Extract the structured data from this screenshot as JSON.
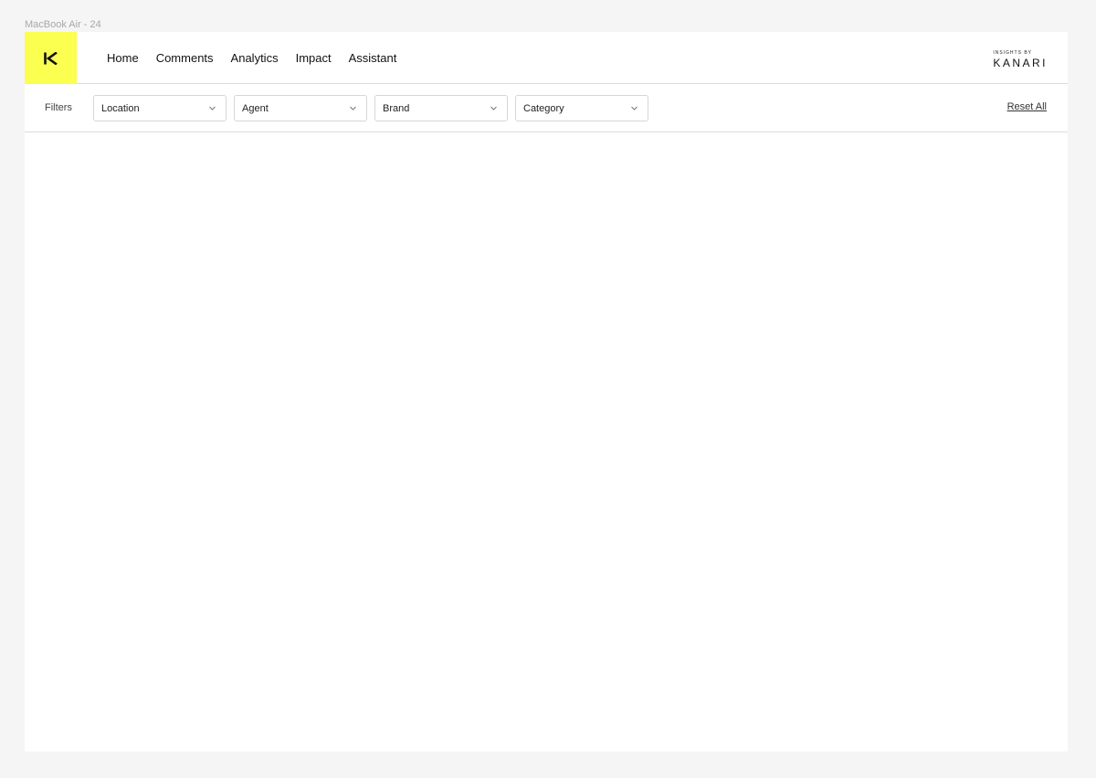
{
  "frame": {
    "label": "MacBook Air - 24"
  },
  "logo": {
    "letter": "K",
    "bg_color": "#fbff4f",
    "icon": "kanari-k-logo-icon"
  },
  "nav": {
    "items": [
      {
        "label": "Home"
      },
      {
        "label": "Comments"
      },
      {
        "label": "Analytics"
      },
      {
        "label": "Impact"
      },
      {
        "label": "Assistant"
      }
    ]
  },
  "brand": {
    "small": "INSIGHTS BY",
    "big": "KANARI"
  },
  "filters": {
    "label": "Filters",
    "selects": [
      {
        "label": "Location",
        "icon": "chevron-down-icon"
      },
      {
        "label": "Agent",
        "icon": "chevron-down-icon"
      },
      {
        "label": "Brand",
        "icon": "chevron-down-icon"
      },
      {
        "label": "Category",
        "icon": "chevron-down-icon"
      }
    ],
    "reset_label": "Reset All"
  }
}
